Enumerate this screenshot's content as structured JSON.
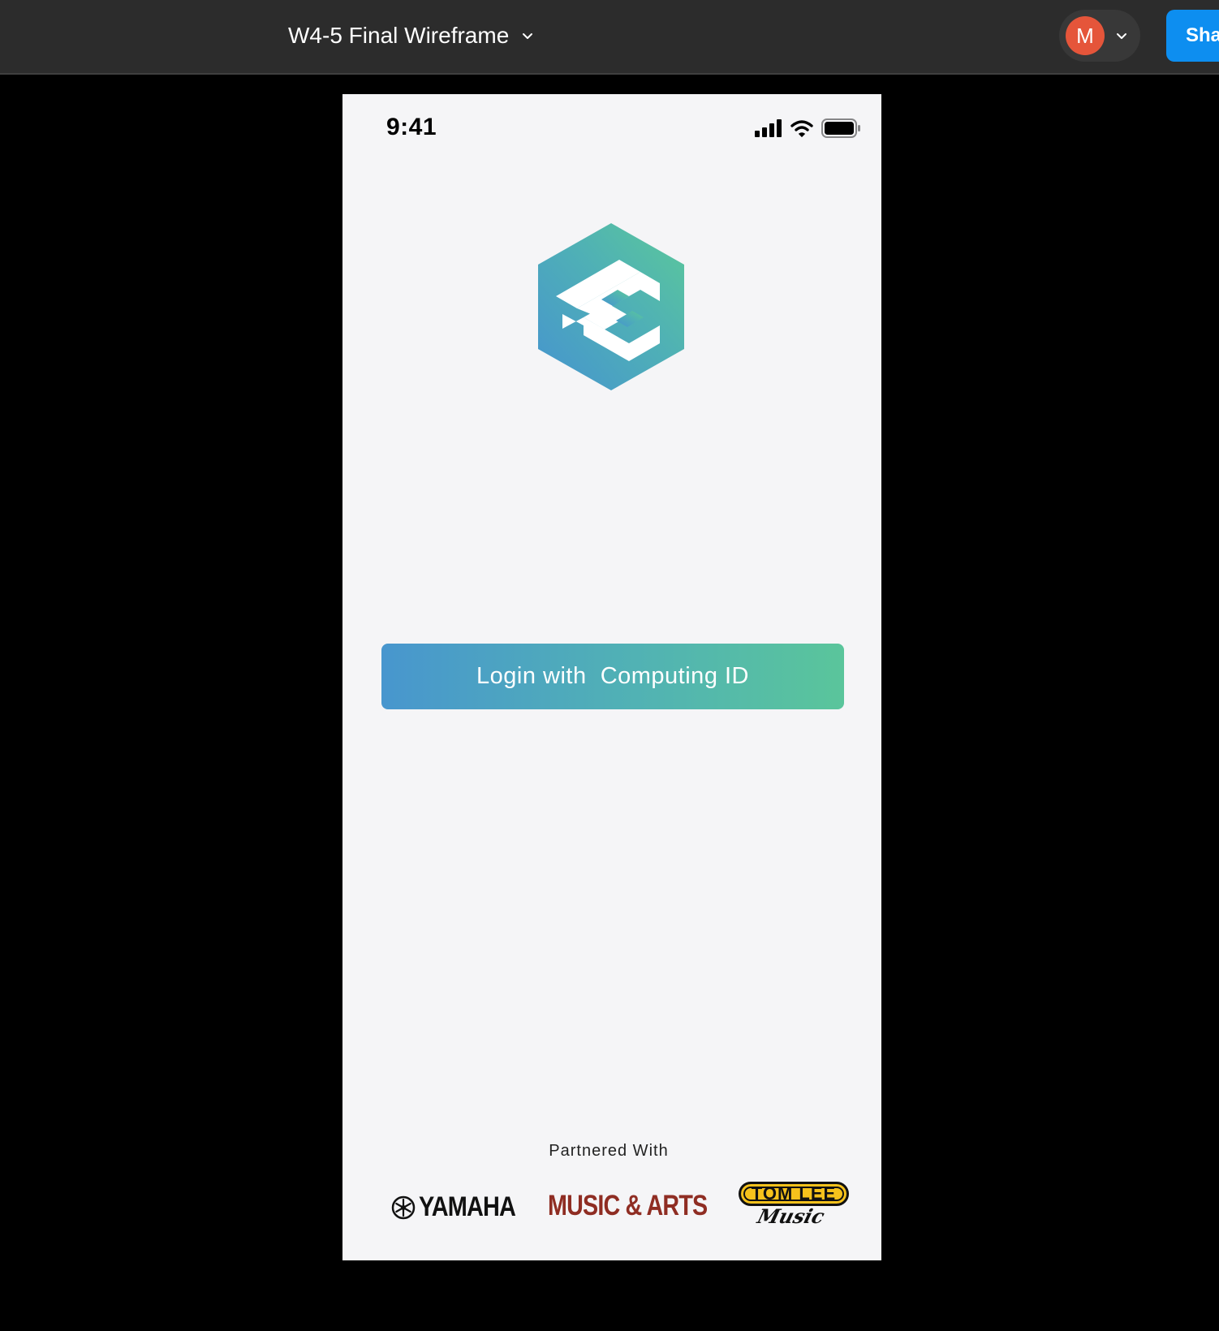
{
  "toolbar": {
    "file_title": "W4-5 Final Wireframe",
    "user_initial": "M",
    "share_label": "Sha",
    "avatar_color": "#e5553a",
    "share_color": "#0d8ef0"
  },
  "status_bar": {
    "time": "9:41",
    "icons": [
      "cellular-signal-icon",
      "wifi-icon",
      "battery-icon"
    ]
  },
  "login": {
    "button_label": "Login with  Computing ID",
    "gradient": [
      "#4896ce",
      "#5ac59b"
    ]
  },
  "partners": {
    "label": "Partnered With",
    "logos": [
      {
        "name": "YAMAHA"
      },
      {
        "name": "MUSIC & ARTS"
      },
      {
        "name": "TOM LEE",
        "script": "Music"
      }
    ]
  }
}
